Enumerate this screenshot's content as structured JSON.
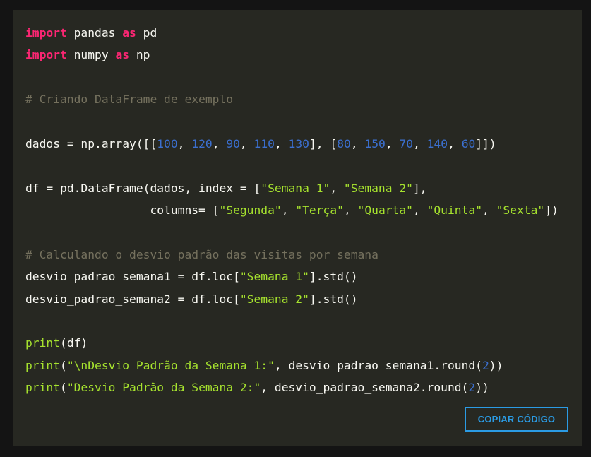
{
  "colors": {
    "background": "#141414",
    "panel": "#272822",
    "keyword": "#f92672",
    "function": "#a6e22e",
    "number": "#3b6fcf",
    "string": "#a6e22e",
    "comment": "#75715e",
    "text": "#f8f8f2",
    "button": "#2b9be4"
  },
  "code_lines": [
    [
      {
        "t": "import",
        "c": "kw"
      },
      {
        "t": " pandas ",
        "c": "plain"
      },
      {
        "t": "as",
        "c": "kw"
      },
      {
        "t": " pd",
        "c": "plain"
      }
    ],
    [
      {
        "t": "import",
        "c": "kw"
      },
      {
        "t": " numpy ",
        "c": "plain"
      },
      {
        "t": "as",
        "c": "kw"
      },
      {
        "t": " np",
        "c": "plain"
      }
    ],
    [],
    [
      {
        "t": "# Criando DataFrame de exemplo",
        "c": "cmt"
      }
    ],
    [],
    [
      {
        "t": "dados = np.array([[",
        "c": "plain"
      },
      {
        "t": "100",
        "c": "num"
      },
      {
        "t": ", ",
        "c": "plain"
      },
      {
        "t": "120",
        "c": "num"
      },
      {
        "t": ", ",
        "c": "plain"
      },
      {
        "t": "90",
        "c": "num"
      },
      {
        "t": ", ",
        "c": "plain"
      },
      {
        "t": "110",
        "c": "num"
      },
      {
        "t": ", ",
        "c": "plain"
      },
      {
        "t": "130",
        "c": "num"
      },
      {
        "t": "], [",
        "c": "plain"
      },
      {
        "t": "80",
        "c": "num"
      },
      {
        "t": ", ",
        "c": "plain"
      },
      {
        "t": "150",
        "c": "num"
      },
      {
        "t": ", ",
        "c": "plain"
      },
      {
        "t": "70",
        "c": "num"
      },
      {
        "t": ", ",
        "c": "plain"
      },
      {
        "t": "140",
        "c": "num"
      },
      {
        "t": ", ",
        "c": "plain"
      },
      {
        "t": "60",
        "c": "num"
      },
      {
        "t": "]])",
        "c": "plain"
      }
    ],
    [],
    [
      {
        "t": "df = pd.DataFrame(dados, index = [",
        "c": "plain"
      },
      {
        "t": "\"Semana 1\"",
        "c": "str"
      },
      {
        "t": ", ",
        "c": "plain"
      },
      {
        "t": "\"Semana 2\"",
        "c": "str"
      },
      {
        "t": "],",
        "c": "plain"
      }
    ],
    [
      {
        "t": "                  columns= [",
        "c": "plain"
      },
      {
        "t": "\"Segunda\"",
        "c": "str"
      },
      {
        "t": ", ",
        "c": "plain"
      },
      {
        "t": "\"Terça\"",
        "c": "str"
      },
      {
        "t": ", ",
        "c": "plain"
      },
      {
        "t": "\"Quarta\"",
        "c": "str"
      },
      {
        "t": ", ",
        "c": "plain"
      },
      {
        "t": "\"Quinta\"",
        "c": "str"
      },
      {
        "t": ", ",
        "c": "plain"
      },
      {
        "t": "\"Sexta\"",
        "c": "str"
      },
      {
        "t": "])",
        "c": "plain"
      }
    ],
    [],
    [
      {
        "t": "# Calculando o desvio padrão das visitas por semana",
        "c": "cmt"
      }
    ],
    [
      {
        "t": "desvio_padrao_semana1 = df.loc[",
        "c": "plain"
      },
      {
        "t": "\"Semana 1\"",
        "c": "str"
      },
      {
        "t": "].std()",
        "c": "plain"
      }
    ],
    [
      {
        "t": "desvio_padrao_semana2 = df.loc[",
        "c": "plain"
      },
      {
        "t": "\"Semana 2\"",
        "c": "str"
      },
      {
        "t": "].std()",
        "c": "plain"
      }
    ],
    [],
    [
      {
        "t": "print",
        "c": "fn"
      },
      {
        "t": "(df)",
        "c": "plain"
      }
    ],
    [
      {
        "t": "print",
        "c": "fn"
      },
      {
        "t": "(",
        "c": "plain"
      },
      {
        "t": "\"\\nDesvio Padrão da Semana 1:\"",
        "c": "str"
      },
      {
        "t": ", desvio_padrao_semana1.round(",
        "c": "plain"
      },
      {
        "t": "2",
        "c": "num"
      },
      {
        "t": "))",
        "c": "plain"
      }
    ],
    [
      {
        "t": "print",
        "c": "fn"
      },
      {
        "t": "(",
        "c": "plain"
      },
      {
        "t": "\"Desvio Padrão da Semana 2:\"",
        "c": "str"
      },
      {
        "t": ", desvio_padrao_semana2.round(",
        "c": "plain"
      },
      {
        "t": "2",
        "c": "num"
      },
      {
        "t": "))",
        "c": "plain"
      }
    ]
  ],
  "copy_button": {
    "label": "COPIAR CÓDIGO"
  }
}
